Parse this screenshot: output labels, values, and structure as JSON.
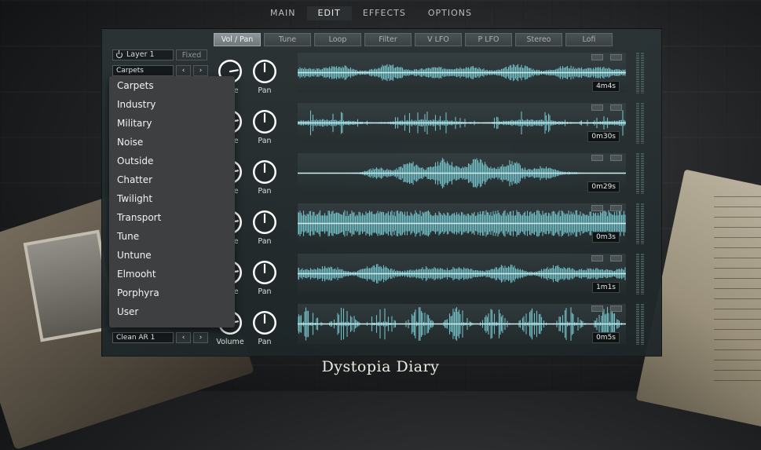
{
  "nav": {
    "items": [
      "MAIN",
      "EDIT",
      "EFFECTS",
      "OPTIONS"
    ],
    "active": "EDIT"
  },
  "tabs": [
    "Vol / Pan",
    "Tune",
    "Loop",
    "Filter",
    "V LFO",
    "P LFO",
    "Stereo",
    "Lofi"
  ],
  "layer": {
    "label": "Layer 1",
    "fixed_label": "Fixed"
  },
  "presets": [
    {
      "value": "Carpets"
    },
    {
      "value": "Clean AR 1"
    }
  ],
  "arrows": {
    "prev": "‹",
    "next": "›"
  },
  "dropdown": {
    "items": [
      "Carpets",
      "Industry",
      "Military",
      "Noise",
      "Outside",
      "Chatter",
      "Twilight",
      "Transport",
      "Tune",
      "Untune",
      "Elmooht",
      "Porphyra",
      "User"
    ]
  },
  "knob_labels": {
    "volume": "Volume",
    "volume_partial": "ume",
    "pan": "Pan"
  },
  "layers": [
    {
      "time": "4m4s"
    },
    {
      "time": "0m30s"
    },
    {
      "time": "0m29s"
    },
    {
      "time": "0m3s"
    },
    {
      "time": "1m1s"
    },
    {
      "time": "0m5s"
    }
  ],
  "title": "Dystopia Diary",
  "colors": {
    "wave": "#7fd6de",
    "wave_core": "#d9f6f8",
    "panel": "#2c3436"
  }
}
